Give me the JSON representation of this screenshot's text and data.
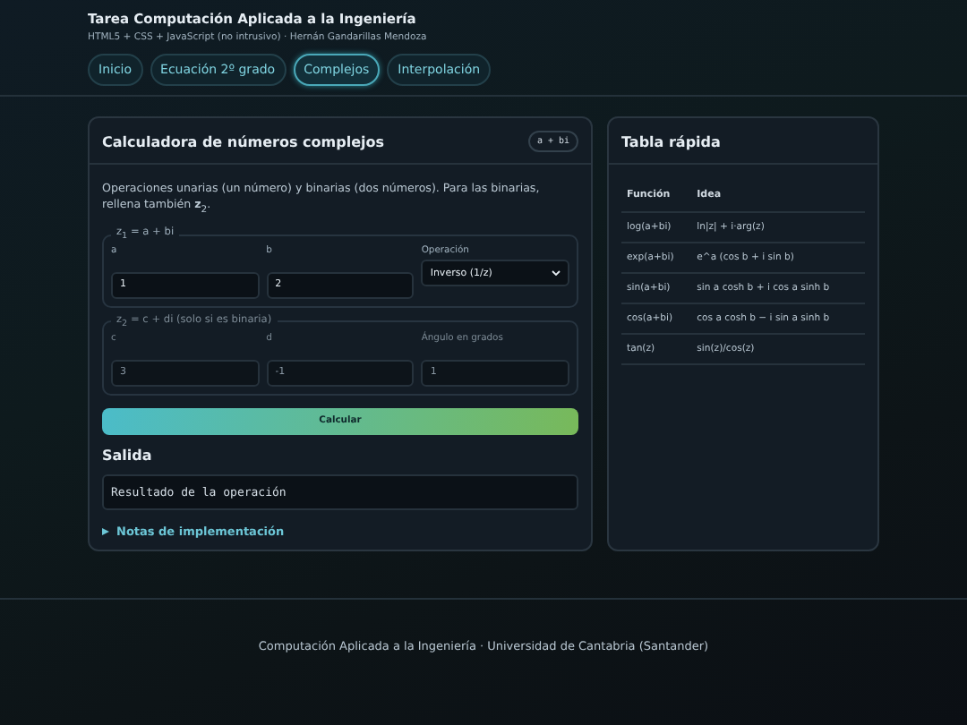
{
  "header": {
    "title": "Tarea Computación Aplicada a la Ingeniería",
    "subtitle": "HTML5 + CSS + JavaScript (no intrusivo) · Hernán Gandarillas Mendoza"
  },
  "tabs": [
    {
      "label": "Inicio",
      "selected": false
    },
    {
      "label": "Ecuación 2º grado",
      "selected": false
    },
    {
      "label": "Complejos",
      "selected": true
    },
    {
      "label": "Interpolación",
      "selected": false
    }
  ],
  "calculator": {
    "title": "Calculadora de números complejos",
    "badge": "a + bi",
    "description": "Operaciones unarias (un número) y binarias (dos números). Para las binarias, rellena también **z**$_{2}$.",
    "groups": [
      {
        "legend": "z$_{1}$ = a + bi",
        "disabled": false,
        "fields": [
          {
            "kind": "input",
            "label": "a",
            "value": "1"
          },
          {
            "kind": "input",
            "label": "b",
            "value": "2"
          },
          {
            "kind": "select",
            "label": "Operación",
            "value": "Inverso (1/z)"
          }
        ]
      },
      {
        "legend": "z$_{2}$ = c + di (solo si es binaria)",
        "disabled": true,
        "fields": [
          {
            "kind": "input",
            "label": "c",
            "value": "3"
          },
          {
            "kind": "input",
            "label": "d",
            "value": "-1"
          },
          {
            "kind": "input",
            "label": "Ángulo en grados",
            "value": "1"
          }
        ]
      }
    ],
    "button": "Calcular",
    "output_heading": "Salida",
    "output": "Resultado de la operación",
    "details": {
      "summary": "Notas de implementación",
      "expanded": false
    }
  },
  "quick_table": {
    "title": "Tabla rápida",
    "columns": [
      "Función",
      "Idea"
    ],
    "rows": [
      [
        "log(a+bi)",
        "ln|z| + i·arg(z)"
      ],
      [
        "exp(a+bi)",
        "e^a (cos b + i sin b)"
      ],
      [
        "sin(a+bi)",
        "sin a cosh b + i cos a sinh b"
      ],
      [
        "cos(a+bi)",
        "cos a cosh b − i sin a sinh b"
      ],
      [
        "tan(z)",
        "sin(z)/cos(z)"
      ]
    ]
  },
  "footer": "Computación Aplicada a la Ingeniería · Universidad de Cantabria (Santander)"
}
